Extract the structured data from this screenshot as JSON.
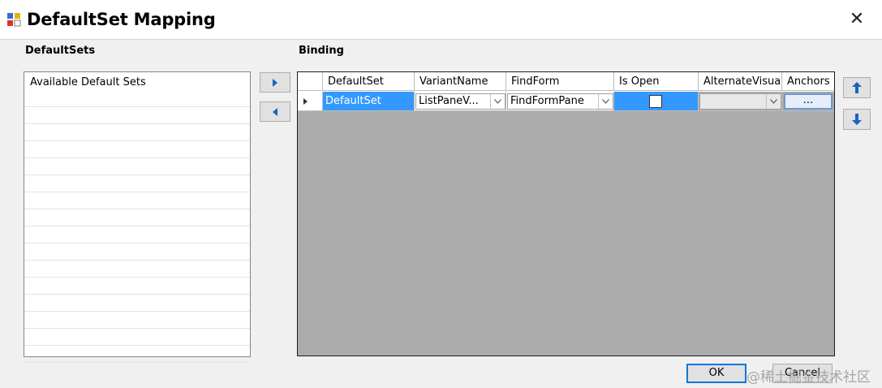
{
  "window": {
    "title": "DefaultSet Mapping",
    "close_glyph": "✕"
  },
  "defaultsets": {
    "label": "DefaultSets",
    "list_header": "Available Default Sets"
  },
  "binding": {
    "label": "Binding",
    "columns": [
      "DefaultSet",
      "VariantName",
      "FindForm",
      "Is Open",
      "AlternateVisual",
      "Anchors"
    ],
    "row": {
      "defaultset": "DefaultSet",
      "variantname": "ListPaneV...",
      "findform": "FindFormPane",
      "is_open": false,
      "alternatevisual": "",
      "anchors": "..."
    }
  },
  "buttons": {
    "ok": "OK",
    "cancel": "Cancel"
  },
  "watermark": "@稀土掘金技术社区",
  "colors": {
    "selection": "#3399ff",
    "grid_bg": "#ababab",
    "arrow_blue": "#1f5fbf"
  }
}
